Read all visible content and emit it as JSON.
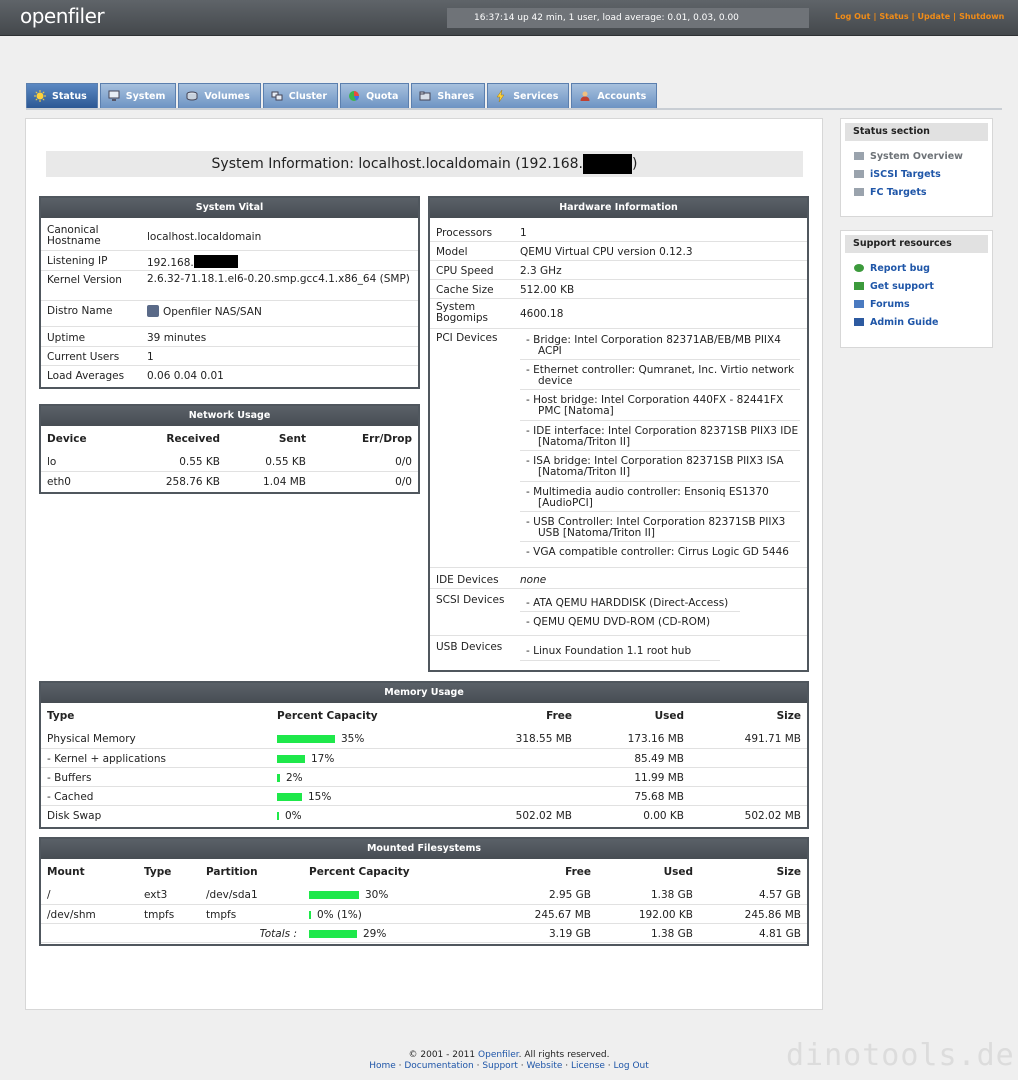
{
  "header": {
    "logo": "openfiler",
    "uptime": "16:37:14 up 42 min, 1 user, load average: 0.01, 0.03, 0.00",
    "links": [
      "Log Out",
      "Status",
      "Update",
      "Shutdown"
    ]
  },
  "tabs": [
    "Status",
    "System",
    "Volumes",
    "Cluster",
    "Quota",
    "Shares",
    "Services",
    "Accounts"
  ],
  "title_prefix": "System Information: localhost.localdomain (192.168.",
  "title_suffix": ")",
  "vital": {
    "title": "System Vital",
    "rows": [
      {
        "k": "Canonical Hostname",
        "v": "localhost.localdomain"
      },
      {
        "k": "Listening IP",
        "v": "192.168."
      },
      {
        "k": "Kernel Version",
        "v": "2.6.32-71.18.1.el6-0.20.smp.gcc4.1.x86_64 (SMP)"
      },
      {
        "k": "Distro Name",
        "v": "Openfiler NAS/SAN"
      },
      {
        "k": "Uptime",
        "v": "39 minutes"
      },
      {
        "k": "Current Users",
        "v": "1"
      },
      {
        "k": "Load Averages",
        "v": "0.06 0.04 0.01"
      }
    ]
  },
  "network": {
    "title": "Network Usage",
    "headers": [
      "Device",
      "Received",
      "Sent",
      "Err/Drop"
    ],
    "rows": [
      [
        "lo",
        "0.55 KB",
        "0.55 KB",
        "0/0"
      ],
      [
        "eth0",
        "258.76 KB",
        "1.04 MB",
        "0/0"
      ]
    ]
  },
  "hardware": {
    "title": "Hardware Information",
    "rows": [
      {
        "k": "Processors",
        "v": "1"
      },
      {
        "k": "Model",
        "v": "QEMU Virtual CPU version 0.12.3"
      },
      {
        "k": "CPU Speed",
        "v": "2.3 GHz"
      },
      {
        "k": "Cache Size",
        "v": "512.00 KB"
      },
      {
        "k": "System Bogomips",
        "v": "4600.18"
      }
    ],
    "pci_label": "PCI Devices",
    "pci": [
      "Bridge: Intel Corporation 82371AB/EB/MB PIIX4 ACPI",
      "Ethernet controller: Qumranet, Inc. Virtio network device",
      "Host bridge: Intel Corporation 440FX - 82441FX PMC [Natoma]",
      "IDE interface: Intel Corporation 82371SB PIIX3 IDE [Natoma/Triton II]",
      "ISA bridge: Intel Corporation 82371SB PIIX3 ISA [Natoma/Triton II]",
      "Multimedia audio controller: Ensoniq ES1370 [AudioPCI]",
      "USB Controller: Intel Corporation 82371SB PIIX3 USB [Natoma/Triton II]",
      "VGA compatible controller: Cirrus Logic GD 5446"
    ],
    "ide_label": "IDE Devices",
    "ide": "none",
    "scsi_label": "SCSI Devices",
    "scsi": [
      "ATA QEMU HARDDISK (Direct-Access)",
      "QEMU QEMU DVD-ROM (CD-ROM)"
    ],
    "usb_label": "USB Devices",
    "usb": [
      "Linux Foundation 1.1 root hub"
    ]
  },
  "memory": {
    "title": "Memory Usage",
    "headers": [
      "Type",
      "Percent Capacity",
      "Free",
      "Used",
      "Size"
    ],
    "rows": [
      {
        "type": "Physical Memory",
        "pct": 35,
        "pct_label": "35%",
        "free": "318.55 MB",
        "used": "173.16 MB",
        "size": "491.71 MB"
      },
      {
        "type": "- Kernel + applications",
        "pct": 17,
        "pct_label": "17%",
        "free": "",
        "used": "85.49 MB",
        "size": ""
      },
      {
        "type": "- Buffers",
        "pct": 2,
        "pct_label": "2%",
        "free": "",
        "used": "11.99 MB",
        "size": ""
      },
      {
        "type": "- Cached",
        "pct": 15,
        "pct_label": "15%",
        "free": "",
        "used": "75.68 MB",
        "size": ""
      },
      {
        "type": "Disk Swap",
        "pct": 0,
        "pct_label": "0%",
        "free": "502.02 MB",
        "used": "0.00 KB",
        "size": "502.02 MB"
      }
    ]
  },
  "filesystems": {
    "title": "Mounted Filesystems",
    "headers": [
      "Mount",
      "Type",
      "Partition",
      "Percent Capacity",
      "Free",
      "Used",
      "Size"
    ],
    "rows": [
      {
        "mount": "/",
        "type": "ext3",
        "partition": "/dev/sda1",
        "pct": 30,
        "pct_label": "30%",
        "free": "2.95 GB",
        "used": "1.38 GB",
        "size": "4.57 GB"
      },
      {
        "mount": "/dev/shm",
        "type": "tmpfs",
        "partition": "tmpfs",
        "pct": 0,
        "pct_label": "0% (1%)",
        "free": "245.67 MB",
        "used": "192.00 KB",
        "size": "245.86 MB"
      }
    ],
    "totals_label": "Totals :",
    "totals": {
      "pct": 29,
      "pct_label": "29%",
      "free": "3.19 GB",
      "used": "1.38 GB",
      "size": "4.81 GB"
    }
  },
  "status_section": {
    "title": "Status section",
    "items": [
      "System Overview",
      "iSCSI Targets",
      "FC Targets"
    ]
  },
  "support": {
    "title": "Support resources",
    "items": [
      "Report bug",
      "Get support",
      "Forums",
      "Admin Guide"
    ]
  },
  "footer": {
    "copyright_prefix": "© 2001 - 2011",
    "copyright_link": "Openfiler",
    "copyright_suffix": ". All rights reserved.",
    "links": [
      "Home",
      "Documentation",
      "Support",
      "Website",
      "License",
      "Log Out"
    ]
  },
  "watermark": "dinotools.de",
  "colors": {
    "bar": "#1ee84a",
    "tab": "#7a9fd0",
    "tab_active": "#3a66a3",
    "link": "#1f56a8",
    "top_link": "#f08c18"
  }
}
